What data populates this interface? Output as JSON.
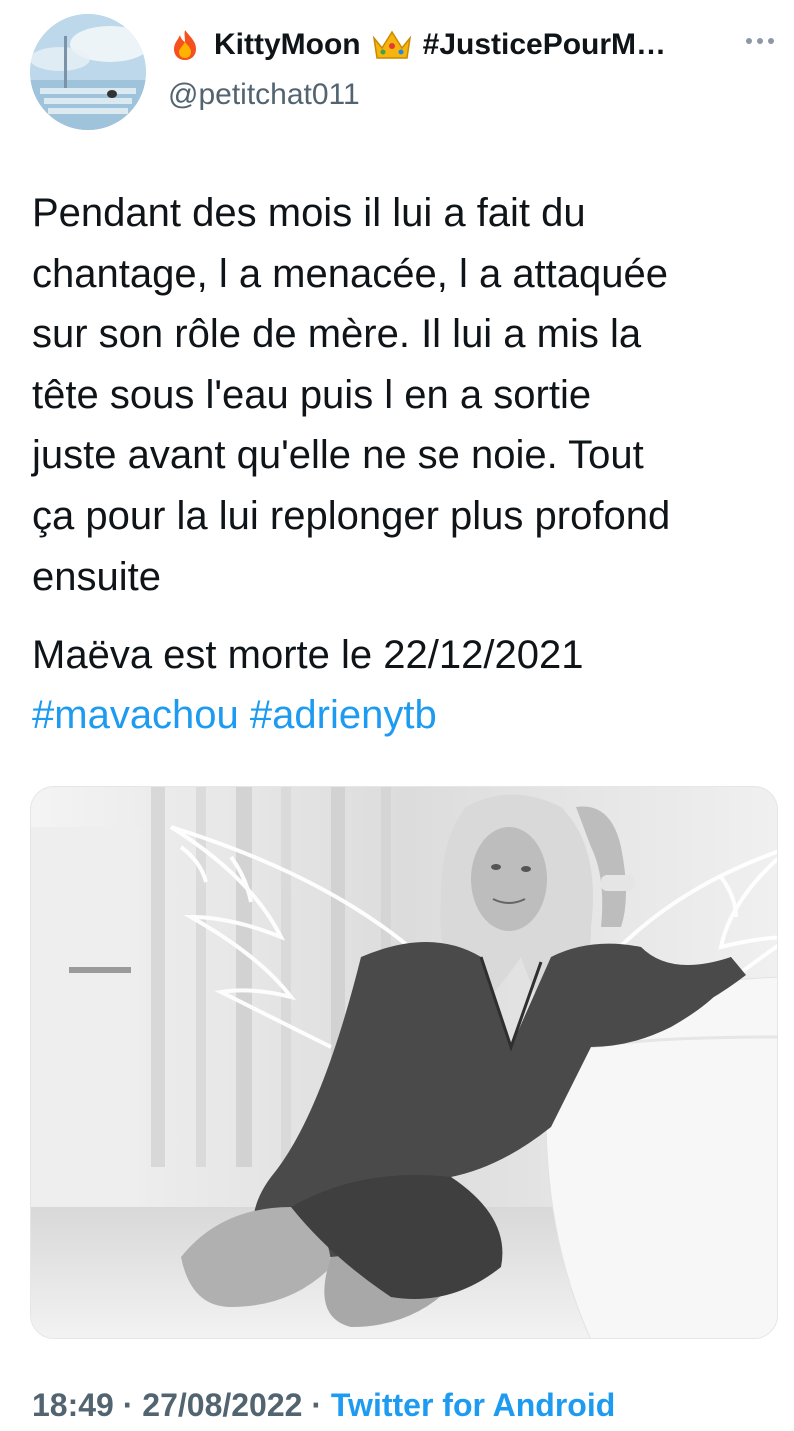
{
  "author": {
    "display_name": "KittyMoon",
    "display_name_suffix": "#JusticePourM…",
    "handle": "@petitchat011",
    "name_prefix_icon": "fire-icon",
    "name_middle_icon": "crown-icon"
  },
  "tweet": {
    "text_lines": [
      "Pendant des mois il lui a fait du",
      "chantage, l a menacée, l a attaquée",
      "sur son rôle de mère. Il lui a mis la",
      "tête sous l'eau puis l en a sortie",
      "juste avant qu'elle ne se noie. Tout",
      "ça pour la lui replonger plus profond",
      "ensuite"
    ],
    "death_line": "Maëva est morte le 22/12/2021",
    "hashtags": [
      "#mavachou",
      "#adrienytb"
    ]
  },
  "meta": {
    "time": "18:49",
    "separator": "·",
    "date": "27/08/2022",
    "source": "Twitter for Android"
  },
  "colors": {
    "link": "#1d9bf0",
    "secondary_text": "#536471",
    "primary_text": "#0f1419"
  }
}
